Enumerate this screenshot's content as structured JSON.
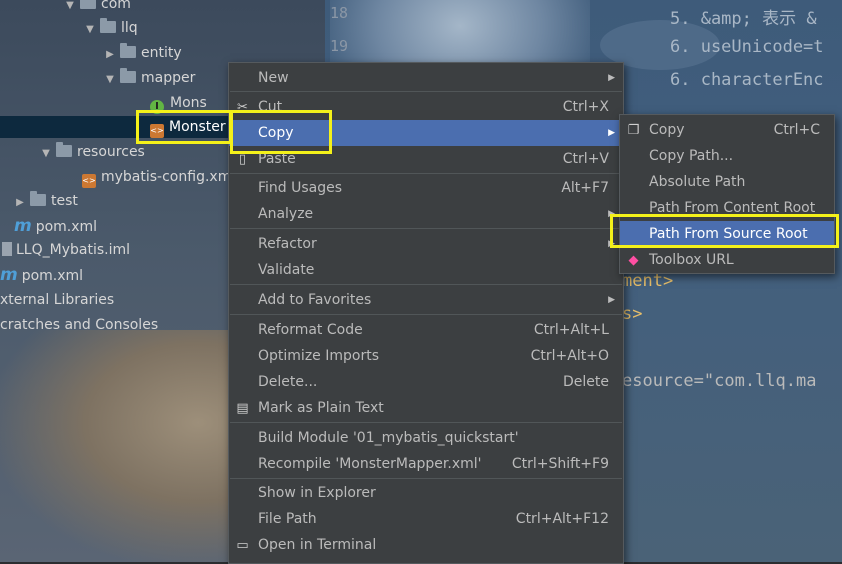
{
  "editor": {
    "line_numbers": [
      "18",
      "19"
    ],
    "code_lines": [
      "5. &amp; 表示 &",
      "6. useUnicode=t",
      "6. characterEnc",
      "ment>",
      "s>",
      "esource=\"com.llq.ma"
    ]
  },
  "tree": {
    "items": [
      {
        "label": "com",
        "type": "package"
      },
      {
        "label": "llq",
        "type": "package"
      },
      {
        "label": "entity",
        "type": "package"
      },
      {
        "label": "mapper",
        "type": "package"
      },
      {
        "label": "Mons",
        "type": "interface"
      },
      {
        "label": "Monster",
        "type": "xml"
      },
      {
        "label": "resources",
        "type": "folder"
      },
      {
        "label": "mybatis-config.xml",
        "type": "xml"
      },
      {
        "label": "test",
        "type": "folder"
      },
      {
        "label": "pom.xml",
        "type": "maven"
      },
      {
        "label": "LLQ_Mybatis.iml",
        "type": "iml"
      },
      {
        "label": "pom.xml",
        "type": "maven"
      },
      {
        "label": "xternal Libraries",
        "type": "lib"
      },
      {
        "label": "cratches and Consoles",
        "type": "scratch"
      }
    ]
  },
  "context_menu": {
    "new": "New",
    "cut": "Cut",
    "cut_sc": "Ctrl+X",
    "copy": "Copy",
    "paste": "Paste",
    "paste_sc": "Ctrl+V",
    "find_usages": "Find Usages",
    "find_usages_sc": "Alt+F7",
    "analyze": "Analyze",
    "refactor": "Refactor",
    "validate": "Validate",
    "add_favorites": "Add to Favorites",
    "reformat": "Reformat Code",
    "reformat_sc": "Ctrl+Alt+L",
    "optimize": "Optimize Imports",
    "optimize_sc": "Ctrl+Alt+O",
    "delete": "Delete...",
    "delete_sc": "Delete",
    "plain_text": "Mark as Plain Text",
    "build_module": "Build Module '01_mybatis_quickstart'",
    "recompile": "Recompile 'MonsterMapper.xml'",
    "recompile_sc": "Ctrl+Shift+F9",
    "show_explorer": "Show in Explorer",
    "file_path": "File Path",
    "file_path_sc": "Ctrl+Alt+F12",
    "open_terminal": "Open in Terminal"
  },
  "copy_submenu": {
    "copy": "Copy",
    "copy_sc": "Ctrl+C",
    "copy_path": "Copy Path...",
    "absolute_path": "Absolute Path",
    "content_root": "Path From Content Root",
    "source_root": "Path From Source Root",
    "toolbox_url": "Toolbox URL"
  },
  "colors": {
    "menu_bg": "#3c3f41",
    "highlight": "#4b6eaf",
    "annotation": "#f4f11a"
  }
}
